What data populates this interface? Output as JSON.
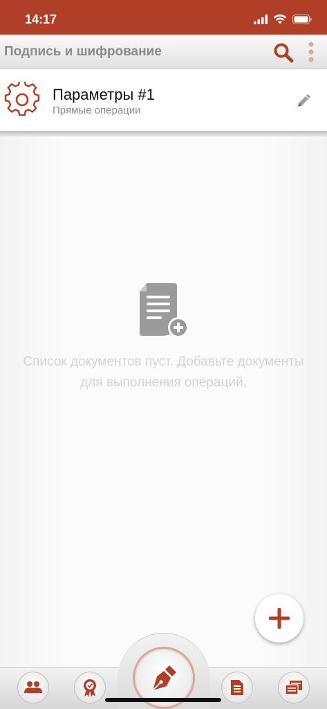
{
  "status": {
    "time": "14:17"
  },
  "toolbar": {
    "title": "Подпись и шифрование",
    "search_icon": "search-icon",
    "more_icon": "more-vertical-icon"
  },
  "params": {
    "title": "Параметры #1",
    "subtitle": "Прямые операции",
    "icon": "gear-icon",
    "edit_icon": "pencil-icon"
  },
  "empty": {
    "icon": "document-add-icon",
    "message": "Список документов пуст. Добавьте документы для выполнения операций."
  },
  "fab": {
    "icon": "plus-icon"
  },
  "tabs": [
    {
      "name": "contacts",
      "icon": "users-icon"
    },
    {
      "name": "certificates",
      "icon": "certificate-icon"
    },
    {
      "name": "sign",
      "icon": "pen-nib-icon"
    },
    {
      "name": "documents",
      "icon": "document-icon"
    },
    {
      "name": "windows",
      "icon": "windows-icon"
    }
  ],
  "colors": {
    "accent": "#b13e26",
    "toolbar_text": "#8a8a8a",
    "empty_text": "#d3d3d3",
    "icon_gray": "#9e9e9e"
  }
}
